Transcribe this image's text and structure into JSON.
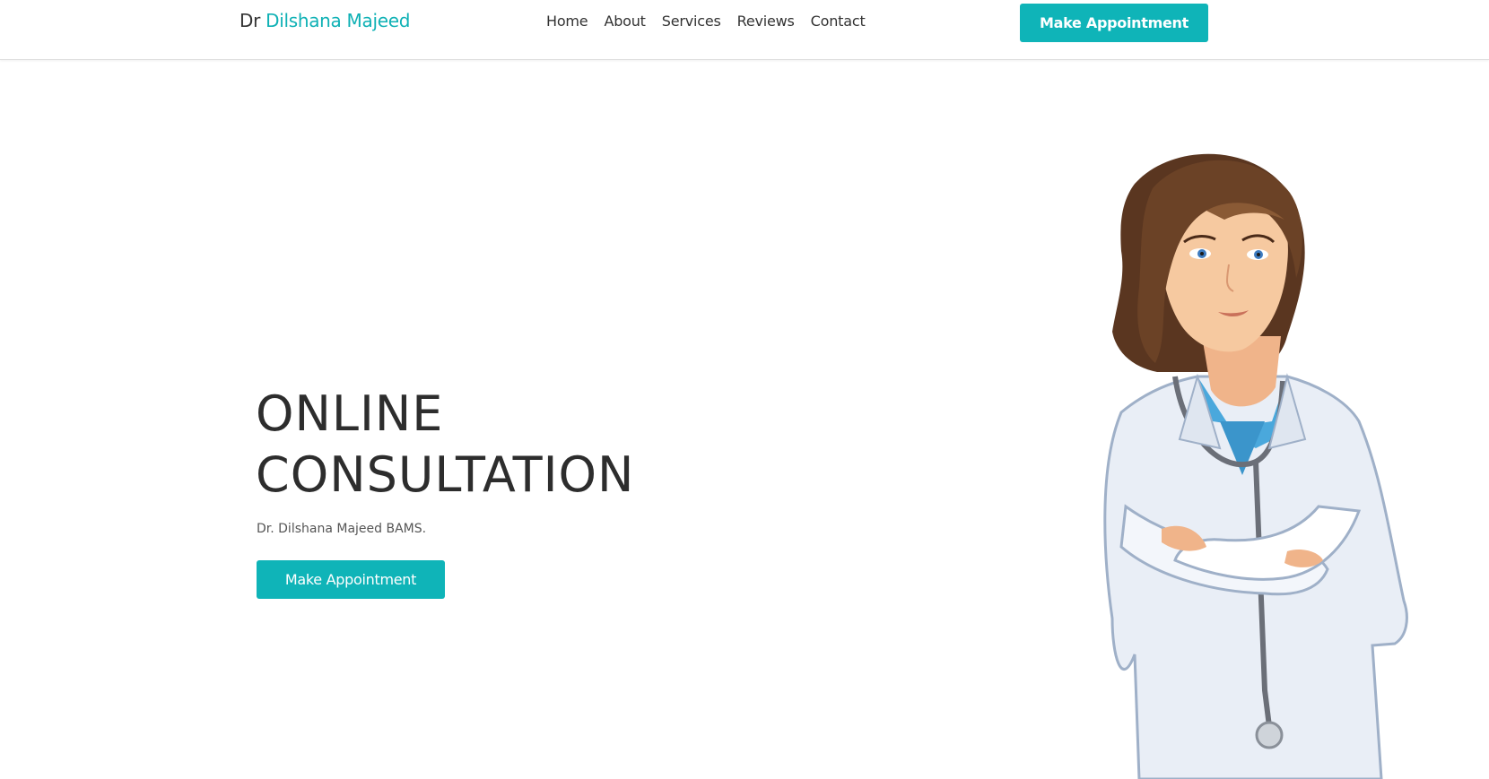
{
  "header": {
    "brand_prefix": "Dr",
    "brand_name": "Dilshana Majeed",
    "nav": [
      "Home",
      "About",
      "Services",
      "Reviews",
      "Contact"
    ],
    "cta_label": "Make Appointment"
  },
  "hero": {
    "title_line1": "ONLINE",
    "title_line2": "CONSULTATION",
    "subtitle": "Dr. Dilshana Majeed BAMS.",
    "cta_label": "Make Appointment"
  },
  "colors": {
    "accent": "#0fb4b8",
    "text": "#333333",
    "background": "#ffffff"
  },
  "illustration": "doctor-illustration"
}
